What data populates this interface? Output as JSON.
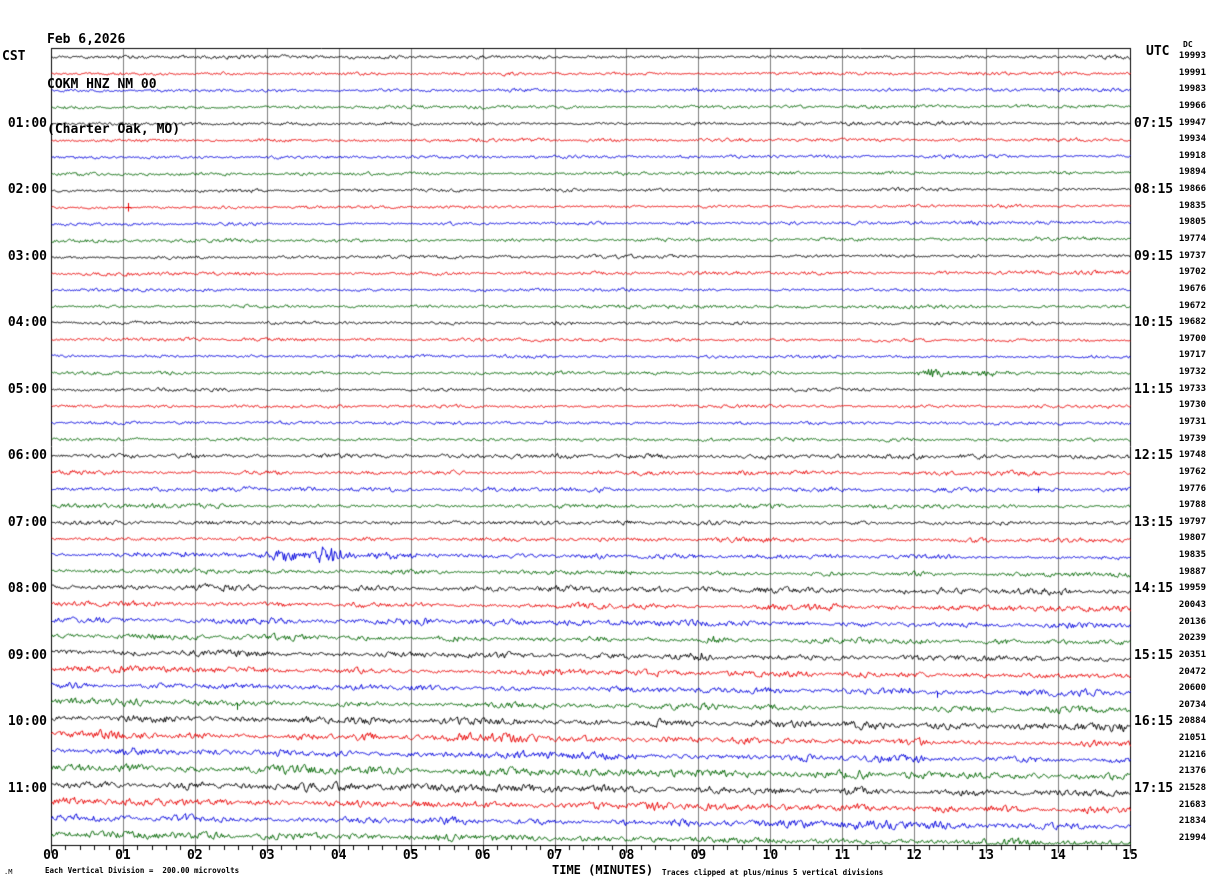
{
  "header": {
    "date": "Feb 6,2026",
    "station": "COKM HNZ NM 00",
    "location": "(Charter Oak, MO)"
  },
  "axis": {
    "left_timezone": "CST",
    "right_timezone": "UTC",
    "x_title": "TIME (MINUTES)",
    "dc_column_header": "DC",
    "x_tick_labels": [
      "00",
      "01",
      "02",
      "03",
      "04",
      "05",
      "06",
      "07",
      "08",
      "09",
      "10",
      "11",
      "12",
      "13",
      "14",
      "15"
    ]
  },
  "footer": {
    "watermark": ".M",
    "scale_note": "Each Vertical Division =  200.00 microvolts",
    "clip_note": "Traces clipped at plus/minus 5 vertical divisions"
  },
  "chart_data": {
    "type": "line",
    "subtype": "helicorder-seismogram",
    "minutes_per_row": 15,
    "x_range_minutes": [
      0,
      15
    ],
    "rows_count": 48,
    "trace_color_cycle": [
      "#000000",
      "#e80000",
      "#0000dd",
      "#006600"
    ],
    "grid_color": "#7d7d7d",
    "left_hour_labels": [
      {
        "row": 4,
        "label": "01:00"
      },
      {
        "row": 8,
        "label": "02:00"
      },
      {
        "row": 12,
        "label": "03:00"
      },
      {
        "row": 16,
        "label": "04:00"
      },
      {
        "row": 20,
        "label": "05:00"
      },
      {
        "row": 24,
        "label": "06:00"
      },
      {
        "row": 28,
        "label": "07:00"
      },
      {
        "row": 32,
        "label": "08:00"
      },
      {
        "row": 36,
        "label": "09:00"
      },
      {
        "row": 40,
        "label": "10:00"
      },
      {
        "row": 44,
        "label": "11:00"
      }
    ],
    "right_hour_labels": [
      {
        "row": 4,
        "label": "07:15"
      },
      {
        "row": 8,
        "label": "08:15"
      },
      {
        "row": 12,
        "label": "09:15"
      },
      {
        "row": 16,
        "label": "10:15"
      },
      {
        "row": 20,
        "label": "11:15"
      },
      {
        "row": 24,
        "label": "12:15"
      },
      {
        "row": 28,
        "label": "13:15"
      },
      {
        "row": 32,
        "label": "14:15"
      },
      {
        "row": 36,
        "label": "15:15"
      },
      {
        "row": 40,
        "label": "16:15"
      },
      {
        "row": 44,
        "label": "17:15"
      }
    ],
    "dc_values": [
      19993,
      19991,
      19983,
      19966,
      19947,
      19934,
      19918,
      19894,
      19866,
      19835,
      19805,
      19774,
      19737,
      19702,
      19676,
      19672,
      19682,
      19700,
      19717,
      19732,
      19733,
      19730,
      19731,
      19739,
      19748,
      19762,
      19776,
      19788,
      19797,
      19807,
      19835,
      19887,
      19959,
      20043,
      20136,
      20239,
      20351,
      20472,
      20600,
      20734,
      20884,
      21051,
      21216,
      21376,
      21528,
      21683,
      21834,
      21994
    ],
    "events": [
      {
        "row": 9,
        "minute": 1.07,
        "type": "spike",
        "amp": 4.5
      },
      {
        "row": 19,
        "minute": 12.3,
        "type": "burst",
        "amp": 4.5,
        "dur": 0.5
      },
      {
        "row": 19,
        "minute": 12.85,
        "type": "burst",
        "amp": 2.0,
        "dur": 1.0
      },
      {
        "row": 26,
        "minute": 13.72,
        "type": "spike",
        "amp": 3.2
      },
      {
        "row": 30,
        "minute": 3.85,
        "type": "burst",
        "amp": 8.0,
        "dur": 0.55
      },
      {
        "row": 30,
        "minute": 3.25,
        "type": "burst",
        "amp": 4.5,
        "dur": 0.6
      },
      {
        "row": 30,
        "minute": 2.0,
        "type": "burst",
        "amp": 1.6,
        "dur": 3.0
      },
      {
        "row": 30,
        "minute": 4.8,
        "type": "burst",
        "amp": 1.8,
        "dur": 1.2
      },
      {
        "row": 35,
        "minute": 9.2,
        "type": "burst",
        "amp": 1.8,
        "dur": 0.2
      },
      {
        "row": 36,
        "minute": 9.05,
        "type": "burst",
        "amp": 2.8,
        "dur": 0.3
      },
      {
        "row": 38,
        "minute": 11.87,
        "type": "burst",
        "amp": 2.8,
        "dur": 0.25
      },
      {
        "row": 38,
        "minute": 12.32,
        "type": "spike-down",
        "amp": 6.0
      },
      {
        "row": 39,
        "minute": 2.58,
        "type": "spike-down",
        "amp": 7.0
      }
    ]
  }
}
